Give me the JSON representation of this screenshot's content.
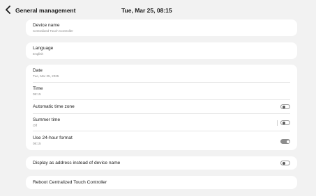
{
  "header": {
    "back_icon": "chevron-left-icon",
    "title": "General management",
    "datetime": "Tue, Mar 25, 08:15"
  },
  "device_name": {
    "label": "Device name",
    "value": "Centralized Touch Controller"
  },
  "language": {
    "label": "Language",
    "value": "English"
  },
  "datetime_settings": {
    "date": {
      "label": "Date",
      "value": "Tue, Mar 25, 2025"
    },
    "time": {
      "label": "Time",
      "value": "08:15"
    },
    "auto_timezone": {
      "label": "Automatic time zone",
      "enabled": false
    },
    "summer_time": {
      "label": "Summer time",
      "value": "Off",
      "enabled": false
    },
    "format_24h": {
      "label": "Use 24-hour format",
      "value": "08:15",
      "enabled": true
    }
  },
  "display_address": {
    "label": "Display as address instead of device name",
    "enabled": false
  },
  "reboot": {
    "label": "Reboot Centralized Touch Controller"
  },
  "colors": {
    "background": "#f2f2f2",
    "card": "#ffffff",
    "toggle_on": "#8d8d8d",
    "toggle_off_border": "#9a9a9a"
  }
}
